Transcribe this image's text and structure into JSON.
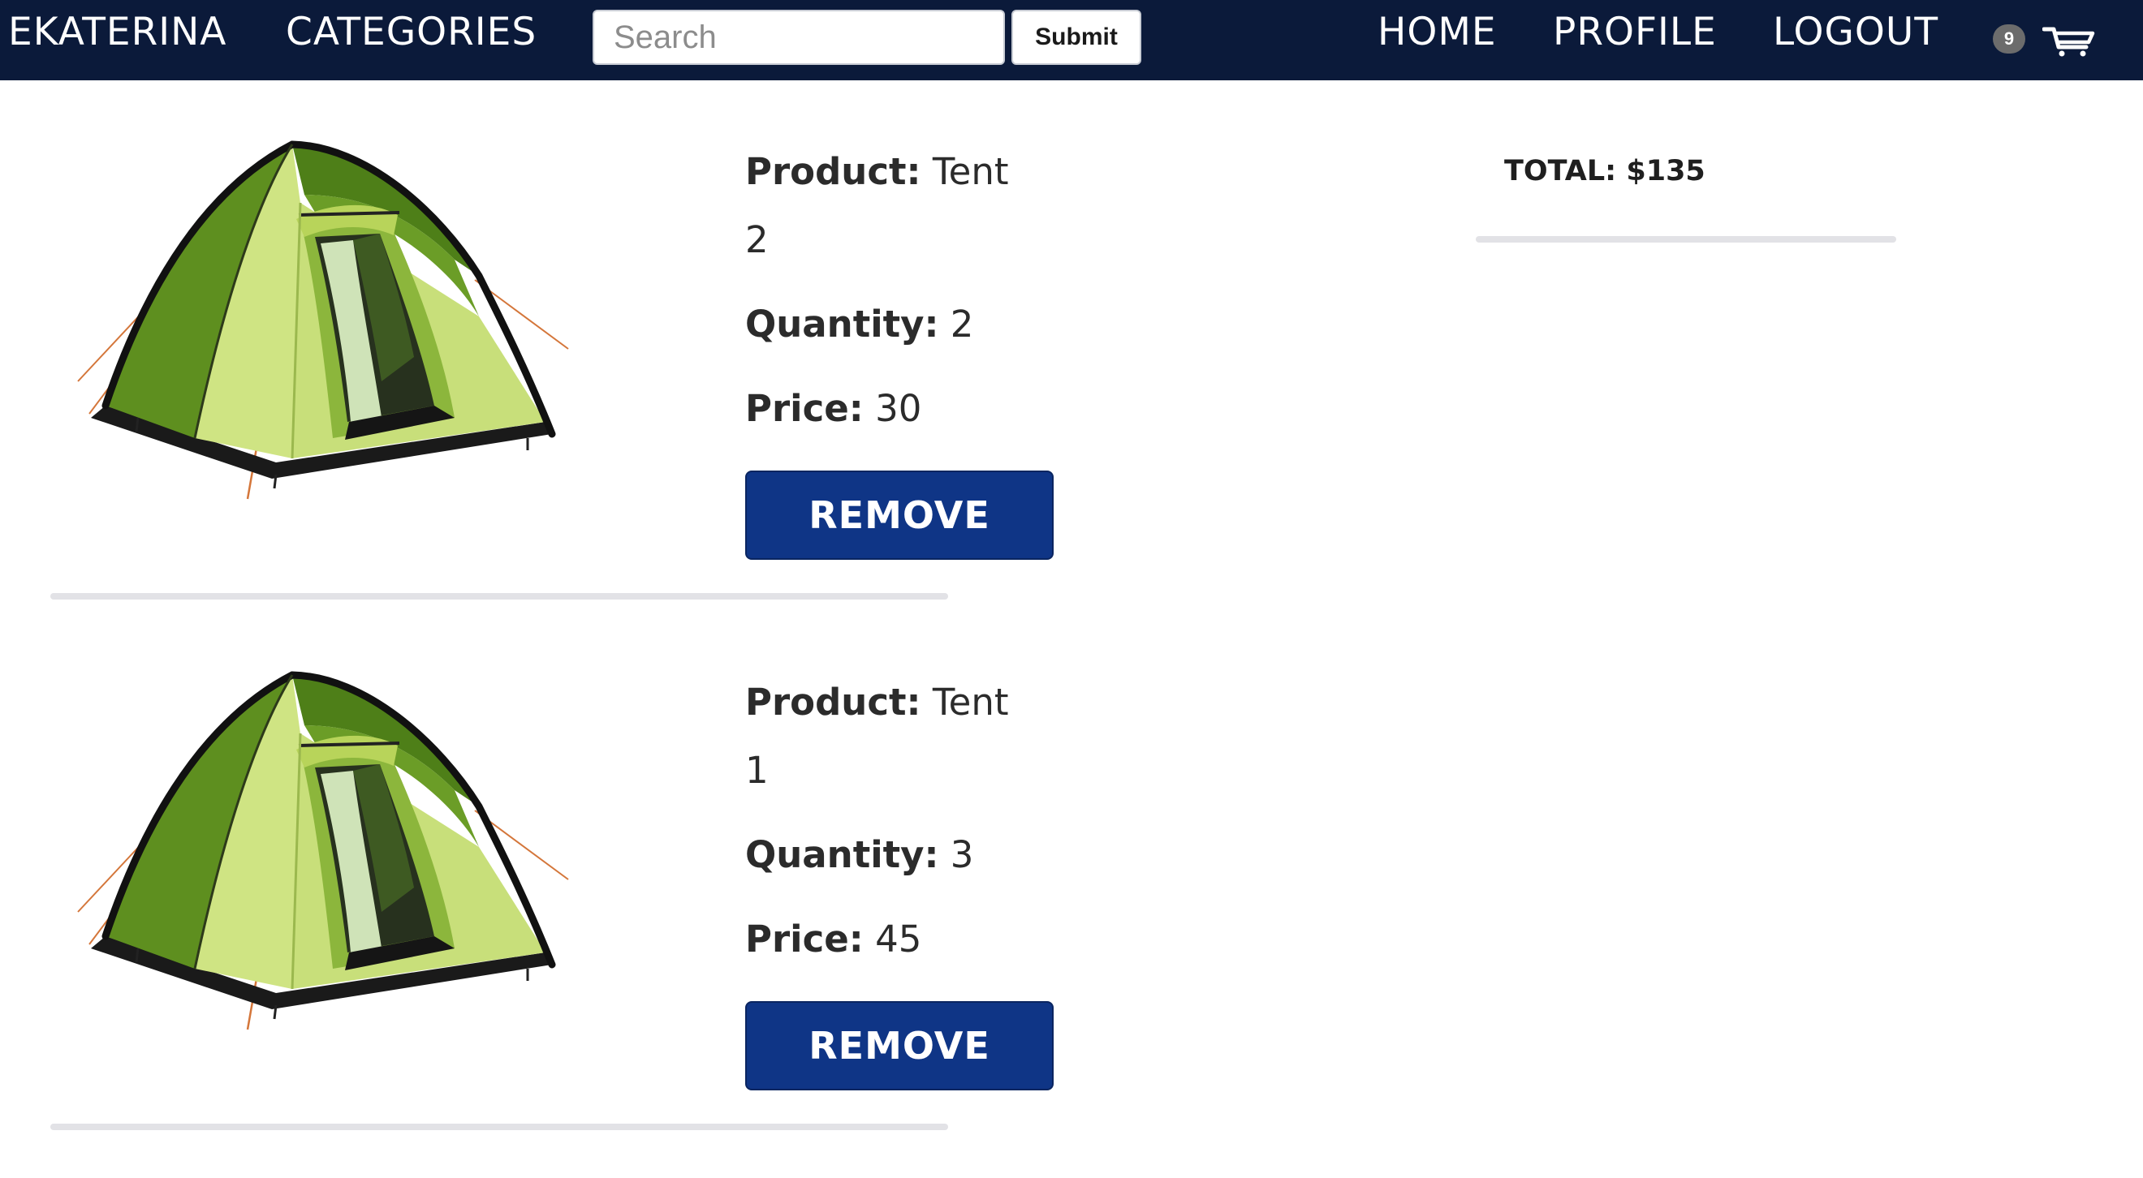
{
  "nav": {
    "brand": "EKATERINA",
    "categories": "CATEGORIES",
    "search_placeholder": "Search",
    "submit_label": "Submit",
    "home": "HOME",
    "profile": "PROFILE",
    "logout": "LOGOUT",
    "cart_count": "9",
    "cart_icon": "shopping-cart-icon"
  },
  "labels": {
    "product": "Product:",
    "quantity": "Quantity:",
    "price": "Price:",
    "remove": "REMOVE"
  },
  "items": [
    {
      "name_part1": "Tent",
      "name_part2": "2",
      "quantity": "2",
      "price": "30",
      "image": "tent-image"
    },
    {
      "name_part1": "Tent",
      "name_part2": "1",
      "quantity": "3",
      "price": "45",
      "image": "tent-image"
    }
  ],
  "summary": {
    "total": "TOTAL: $135"
  },
  "colors": {
    "navbar": "#0b1a3a",
    "button": "#0f3586",
    "divider": "#e2e2e6",
    "tent_light": "#d4e88a",
    "tent_dark": "#5c8a1e"
  }
}
